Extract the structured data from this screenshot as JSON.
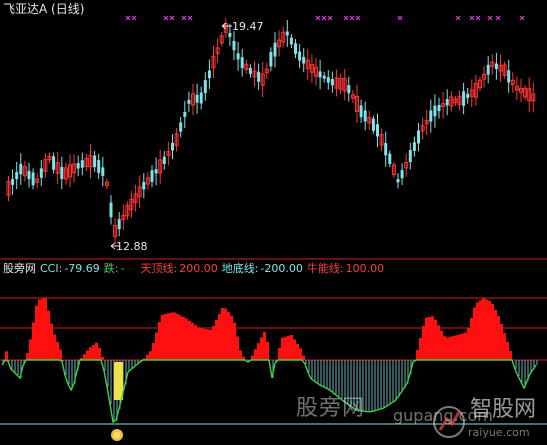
{
  "header": {
    "title": "飞亚达A (日线)",
    "high_label": "19.47",
    "low_label": "12.88"
  },
  "indicator": {
    "name": "股旁网",
    "cci_label": "CCI:",
    "cci_value": "-79.69",
    "die_label": "跌:",
    "die_value": "-",
    "tianding_label": "天顶线:",
    "tianding_value": "200.00",
    "didi_label": "地底线:",
    "didi_value": "-200.00",
    "niuneng_label": "牛能线:",
    "niuneng_value": "100.00"
  },
  "watermark": {
    "site_name": "股旁网",
    "site_url": "gupang.com",
    "brand": "智股网",
    "brand_url": "raiyue.com"
  },
  "colors": {
    "background": "#000000",
    "up_candle": "#ff3535",
    "down_candle": "#7fe3ea",
    "marker": "#d040d0",
    "cci_bar_red": "#ff1010",
    "cci_line_green": "#3fd04a",
    "cci_line_cyan": "#7fe3ea",
    "yellow_bar": "#f1e14b",
    "guide_red": "#d02020",
    "guide_cyan": "#7fe3ea"
  },
  "icons": [
    "arrow-left-icon",
    "x-marker-icon",
    "sun-signal-icon",
    "brand-logo-icon"
  ]
}
